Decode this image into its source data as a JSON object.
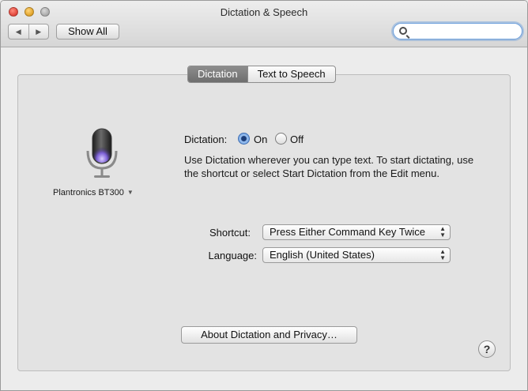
{
  "window": {
    "title": "Dictation & Speech"
  },
  "toolbar": {
    "back_icon": "back-arrow-icon",
    "forward_icon": "forward-arrow-icon",
    "show_all_label": "Show All",
    "search_placeholder": "",
    "search_value": ""
  },
  "tabs": [
    {
      "label": "Dictation",
      "selected": true
    },
    {
      "label": "Text to Speech",
      "selected": false
    }
  ],
  "mic": {
    "icon": "microphone-icon",
    "device": "Plantronics BT300"
  },
  "dictation": {
    "label": "Dictation:",
    "on_label": "On",
    "off_label": "Off",
    "selected": "On",
    "description": "Use Dictation wherever you can type text. To start dictating, use the shortcut or select Start Dictation from the Edit menu."
  },
  "shortcut": {
    "label": "Shortcut:",
    "value": "Press Either Command Key Twice"
  },
  "language": {
    "label": "Language:",
    "value": "English (United States)"
  },
  "about_button": "About Dictation and Privacy…",
  "help": "?",
  "colors": {
    "accent": "#3f6fb5",
    "tab_active": "#7a7a7a",
    "mic_glow": "#7b5fd6"
  }
}
